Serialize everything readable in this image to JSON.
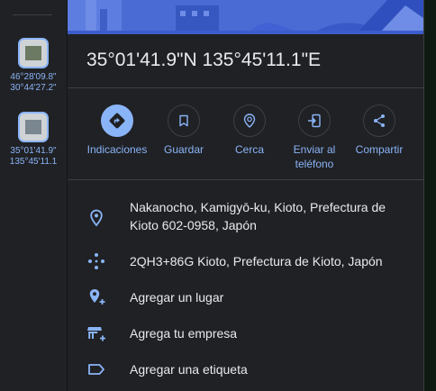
{
  "recents": [
    {
      "coord_line1": "46°28'09.8\"",
      "coord_line2": "30°44'27.2\""
    },
    {
      "coord_line1": "35°01'41.9\"",
      "coord_line2": "135°45'11.1"
    }
  ],
  "place": {
    "title": "35°01'41.9\"N 135°45'11.1\"E"
  },
  "actions": [
    {
      "label": "Indicaciones",
      "icon": "directions-icon"
    },
    {
      "label": "Guardar",
      "icon": "bookmark-icon"
    },
    {
      "label": "Cerca",
      "icon": "nearby-icon"
    },
    {
      "label": "Enviar al teléfono",
      "icon": "send-to-phone-icon"
    },
    {
      "label": "Compartir",
      "icon": "share-icon"
    }
  ],
  "info": {
    "address": "Nakanocho, Kamigyō-ku, Kioto, Prefectura de Kioto 602-0958, Japón",
    "plus_code": "2QH3+86G Kioto, Prefectura de Kioto, Japón",
    "add_place": "Agregar un lugar",
    "add_business": "Agrega tu empresa",
    "add_label": "Agregar una etiqueta"
  },
  "colors": {
    "accent": "#8ab4f8",
    "background": "#202124",
    "text": "#e8eaed",
    "divider": "#3c4043"
  }
}
